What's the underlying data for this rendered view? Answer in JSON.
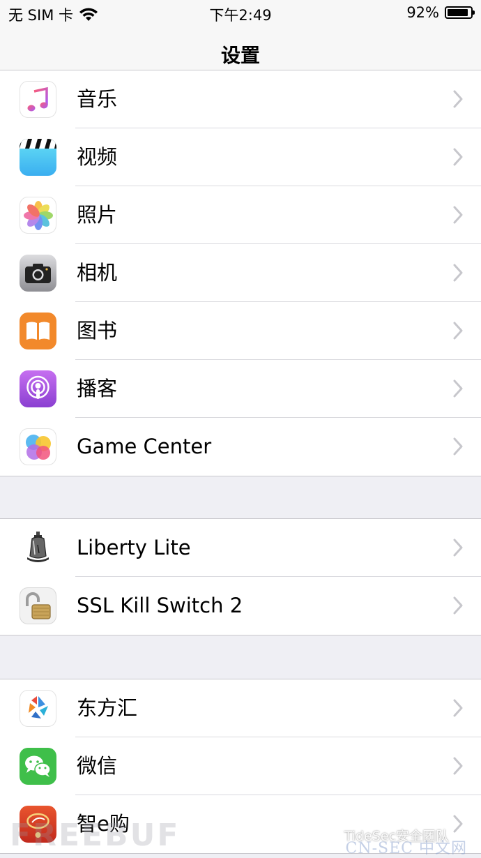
{
  "status_bar": {
    "carrier": "无 SIM 卡",
    "time": "下午2:49",
    "battery": "92%",
    "battery_level": 0.92
  },
  "nav": {
    "title": "设置"
  },
  "groups": [
    {
      "items": [
        {
          "label": "音乐",
          "icon": "music-icon"
        },
        {
          "label": "视频",
          "icon": "video-icon"
        },
        {
          "label": "照片",
          "icon": "photos-icon"
        },
        {
          "label": "相机",
          "icon": "camera-icon"
        },
        {
          "label": "图书",
          "icon": "books-icon"
        },
        {
          "label": "播客",
          "icon": "podcasts-icon"
        },
        {
          "label": "Game Center",
          "icon": "game-center-icon"
        }
      ]
    },
    {
      "items": [
        {
          "label": "Liberty Lite",
          "icon": "liberty-bell-icon"
        },
        {
          "label": "SSL Kill Switch 2",
          "icon": "padlock-icon"
        }
      ]
    },
    {
      "items": [
        {
          "label": "东方汇",
          "icon": "dongfanghui-icon"
        },
        {
          "label": "微信",
          "icon": "wechat-icon"
        },
        {
          "label": "智e购",
          "icon": "zhiegou-icon"
        }
      ]
    }
  ],
  "watermarks": {
    "freebuf": "FREEBUF",
    "tidesec": "TideSec安全团队",
    "cnsec": "CN-SEC 中文网"
  }
}
